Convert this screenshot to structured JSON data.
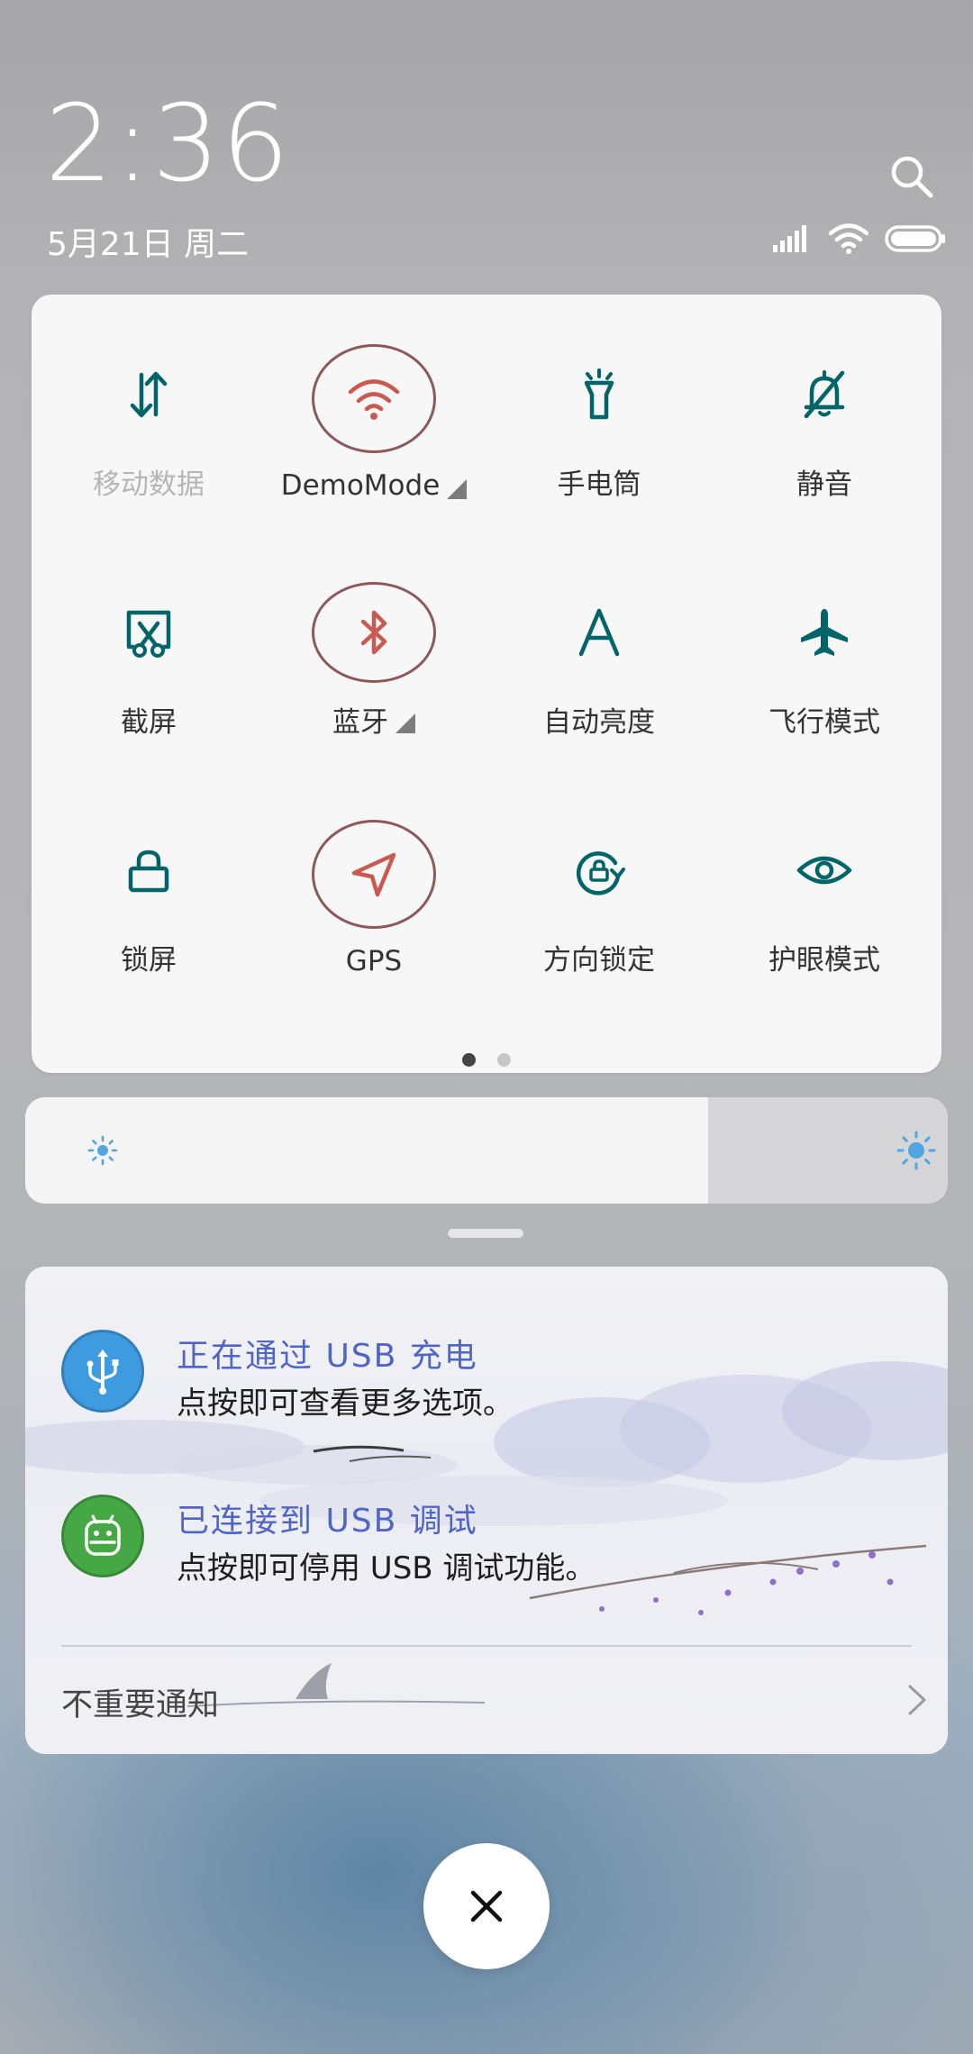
{
  "status": {
    "time": "2:36",
    "date": "5月21日 周二"
  },
  "quick_settings": {
    "tiles": [
      {
        "label": "移动数据",
        "icon": "mobile-data-icon",
        "active": false,
        "disabled": true
      },
      {
        "label": "DemoMode",
        "icon": "wifi-icon",
        "active": true,
        "has_menu": true
      },
      {
        "label": "手电筒",
        "icon": "flashlight-icon",
        "active": false
      },
      {
        "label": "静音",
        "icon": "mute-bell-icon",
        "active": false
      },
      {
        "label": "截屏",
        "icon": "screenshot-icon",
        "active": false
      },
      {
        "label": "蓝牙",
        "icon": "bluetooth-icon",
        "active": true,
        "has_menu": true
      },
      {
        "label": "自动亮度",
        "icon": "auto-brightness-icon",
        "active": false
      },
      {
        "label": "飞行模式",
        "icon": "airplane-icon",
        "active": false
      },
      {
        "label": "锁屏",
        "icon": "lock-icon",
        "active": false
      },
      {
        "label": "GPS",
        "icon": "location-arrow-icon",
        "active": true
      },
      {
        "label": "方向锁定",
        "icon": "rotation-lock-icon",
        "active": false
      },
      {
        "label": "护眼模式",
        "icon": "eye-icon",
        "active": false
      }
    ],
    "pages": 2,
    "current_page": 1
  },
  "brightness": {
    "level": 0.74
  },
  "notifications": [
    {
      "title": "正在通过 USB 充电",
      "body": "点按即可查看更多选项。",
      "icon": "usb-icon",
      "icon_color": "#3f9be0"
    },
    {
      "title": "已连接到 USB 调试",
      "body": "点按即可停用 USB 调试功能。",
      "icon": "android-icon",
      "icon_color": "#45a844"
    }
  ],
  "unimportant": {
    "label": "不重要通知"
  },
  "colors": {
    "accent_teal": "#006468",
    "active_red": "#c85a50",
    "notif_title": "#4f66c4"
  }
}
